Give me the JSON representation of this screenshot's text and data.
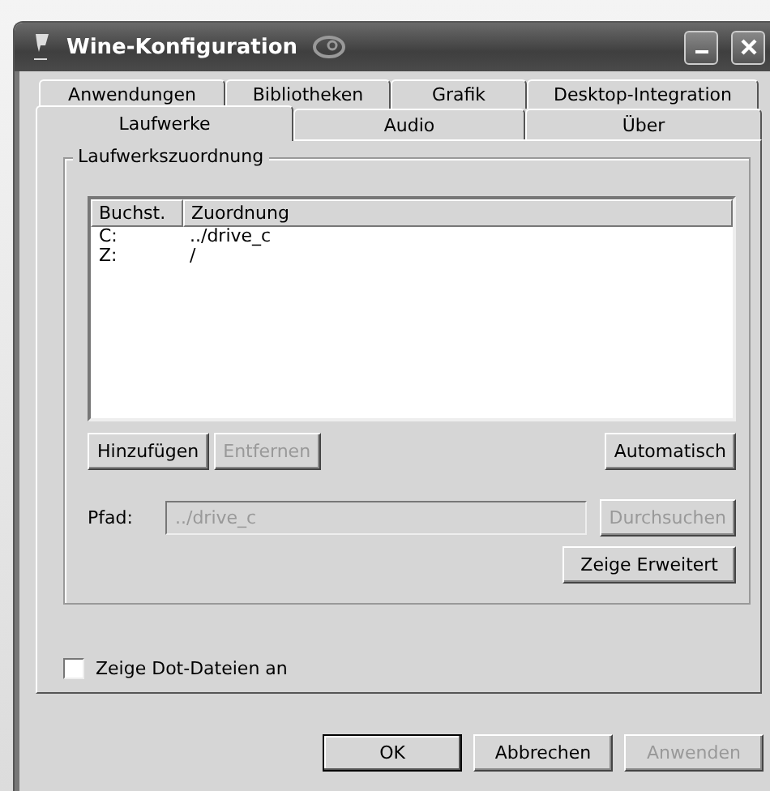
{
  "window": {
    "title": "Wine-Konfiguration"
  },
  "tab_rows": [
    [
      {
        "label": "Anwendungen",
        "selected": false
      },
      {
        "label": "Bibliotheken",
        "selected": false
      },
      {
        "label": "Grafik",
        "selected": false
      },
      {
        "label": "Desktop-Integration",
        "selected": false
      }
    ],
    [
      {
        "label": "Laufwerke",
        "selected": true
      },
      {
        "label": "Audio",
        "selected": false
      },
      {
        "label": "Über",
        "selected": false
      }
    ]
  ],
  "group": {
    "title": "Laufwerkszuordnung"
  },
  "table": {
    "columns": [
      "Buchst.",
      "Zuordnung"
    ],
    "rows": [
      [
        "C:",
        "../drive_c"
      ],
      [
        "Z:",
        "/"
      ]
    ]
  },
  "drive_buttons": [
    {
      "label": "Hinzufügen",
      "disabled": false
    },
    {
      "label": "Entfernen",
      "disabled": true
    },
    {
      "label": "Automatisch",
      "disabled": false
    }
  ],
  "path": {
    "label": "Pfad:",
    "value": "../drive_c",
    "disabled": true,
    "browse": {
      "label": "Durchsuchen",
      "disabled": true
    }
  },
  "advanced_button": {
    "label": "Zeige Erweitert",
    "disabled": false
  },
  "checkbox": {
    "label": "Zeige Dot-Dateien an",
    "checked": false
  },
  "buttons": [
    {
      "label": "OK",
      "disabled": false,
      "default": true
    },
    {
      "label": "Abbrechen",
      "disabled": false,
      "default": false
    },
    {
      "label": "Anwenden",
      "disabled": true,
      "default": false
    }
  ]
}
